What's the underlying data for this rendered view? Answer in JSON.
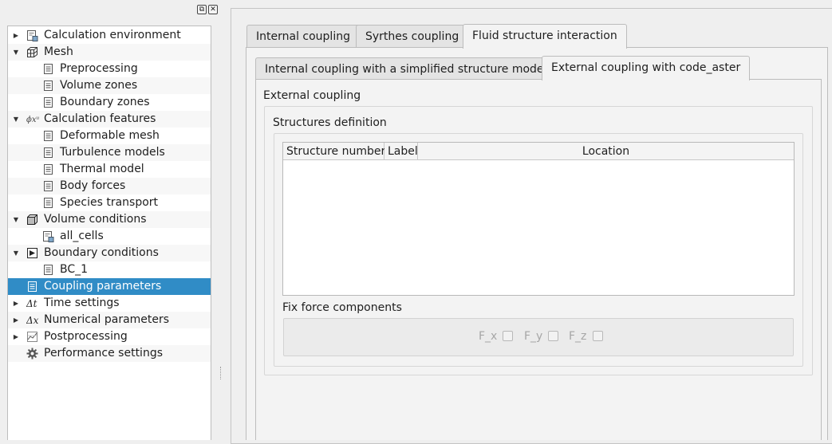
{
  "tree": {
    "items": [
      {
        "label": "Calculation environment",
        "icon": "document-gear-icon",
        "expander": "collapsed",
        "level": 0
      },
      {
        "label": "Mesh",
        "icon": "mesh-cube-icon",
        "expander": "expanded",
        "level": 0
      },
      {
        "label": "Preprocessing",
        "icon": "document-icon",
        "level": 1
      },
      {
        "label": "Volume zones",
        "icon": "document-icon",
        "level": 1
      },
      {
        "label": "Boundary zones",
        "icon": "document-icon",
        "level": 1
      },
      {
        "label": "Calculation features",
        "icon": "formula-icon",
        "expander": "expanded",
        "level": 0
      },
      {
        "label": "Deformable mesh",
        "icon": "document-icon",
        "level": 1
      },
      {
        "label": "Turbulence models",
        "icon": "document-icon",
        "level": 1
      },
      {
        "label": "Thermal model",
        "icon": "document-icon",
        "level": 1
      },
      {
        "label": "Body forces",
        "icon": "document-icon",
        "level": 1
      },
      {
        "label": "Species transport",
        "icon": "document-icon",
        "level": 1
      },
      {
        "label": "Volume conditions",
        "icon": "volume-cube-icon",
        "expander": "expanded",
        "level": 0
      },
      {
        "label": "all_cells",
        "icon": "document-gear-icon",
        "level": 1
      },
      {
        "label": "Boundary conditions",
        "icon": "boundary-icon",
        "expander": "expanded",
        "level": 0
      },
      {
        "label": "BC_1",
        "icon": "document-icon",
        "level": 1
      },
      {
        "label": "Coupling parameters",
        "icon": "document-icon",
        "level": 0,
        "selected": true
      },
      {
        "label": "Time settings",
        "icon": "delta-t-icon",
        "expander": "collapsed",
        "level": 0
      },
      {
        "label": "Numerical parameters",
        "icon": "delta-x-icon",
        "expander": "collapsed",
        "level": 0
      },
      {
        "label": "Postprocessing",
        "icon": "chart-icon",
        "expander": "collapsed",
        "level": 0
      },
      {
        "label": "Performance settings",
        "icon": "gear-icon",
        "level": 0
      }
    ]
  },
  "tabs": {
    "outer": [
      "Internal coupling",
      "Syrthes coupling",
      "Fluid structure interaction"
    ],
    "inner": [
      "Internal coupling with a simplified structure model",
      "External coupling with code_aster"
    ]
  },
  "external": {
    "group_title": "External coupling",
    "structures_title": "Structures definition",
    "columns": [
      "Structure number",
      "Label",
      "Location"
    ],
    "fix_title": "Fix force components",
    "components": [
      "F_x",
      "F_y",
      "F_z"
    ]
  },
  "colors": {
    "selection": "#308cc6"
  }
}
